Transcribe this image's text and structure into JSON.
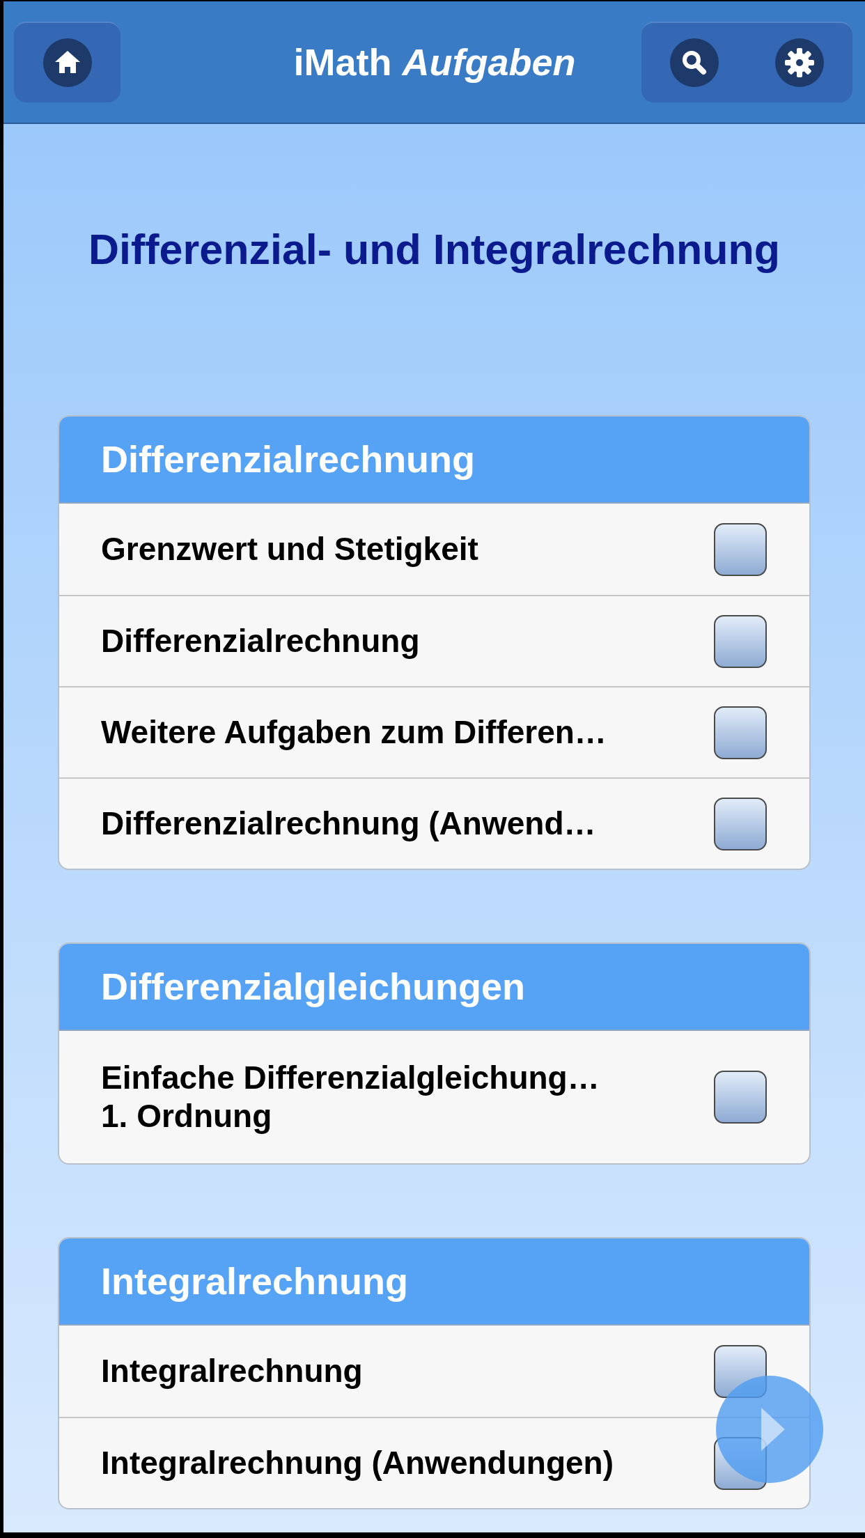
{
  "header": {
    "title": "iMath *Aufgaben*"
  },
  "page_title": "Differenzial- und Integralrechnung",
  "sections": [
    {
      "title": "Differenzialrechnung",
      "items": [
        {
          "label": "Grenzwert und Stetigkeit",
          "checked": false
        },
        {
          "label": "Differenzialrechnung",
          "checked": false
        },
        {
          "label": "Weitere Aufgaben zum Differen…",
          "checked": false
        },
        {
          "label": "Differenzialrechnung (Anwend…",
          "checked": false
        }
      ]
    },
    {
      "title": "Differenzialgleichungen",
      "items": [
        {
          "label": "Einfache Differenzialgleichung…\n1. Ordnung",
          "checked": false
        }
      ]
    },
    {
      "title": "Integralrechnung",
      "items": [
        {
          "label": "Integralrechnung",
          "checked": false
        },
        {
          "label": "Integralrechnung (Anwendungen)",
          "checked": false
        }
      ]
    }
  ]
}
